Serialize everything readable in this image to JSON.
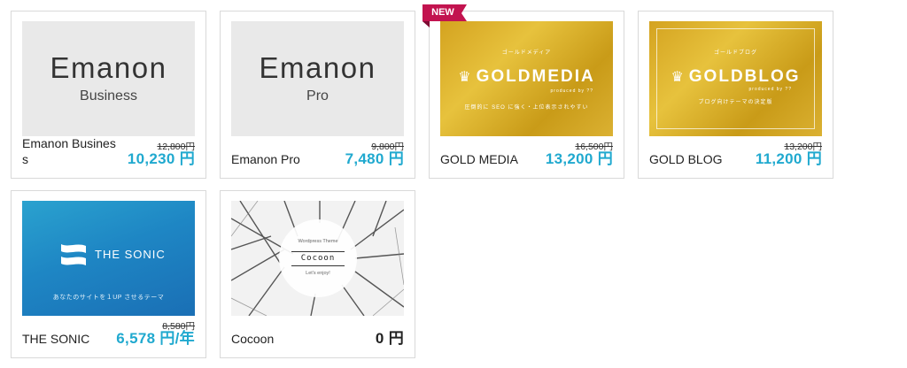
{
  "products": [
    {
      "name": "Emanon Business",
      "old_price": "12,800円",
      "price": "10,230 円",
      "thumb": {
        "logo": "Emanon",
        "sub": "Business"
      }
    },
    {
      "name": "Emanon Pro",
      "old_price": "9,800円",
      "price": "7,480 円",
      "thumb": {
        "logo": "Emanon",
        "sub": "Pro"
      }
    },
    {
      "name": "GOLD MEDIA",
      "old_price": "16,500円",
      "price": "13,200 円",
      "badge": "NEW",
      "thumb": {
        "top": "ゴールドメディア",
        "title": "GOLDMEDIA",
        "by": "produced by ??",
        "tagline": "圧倒的に SEO に強く・上位表示されやすい"
      }
    },
    {
      "name": "GOLD BLOG",
      "old_price": "13,200円",
      "price": "11,200 円",
      "thumb": {
        "top": "ゴールドブログ",
        "title": "GOLDBLOG",
        "by": "produced by ??",
        "tagline": "ブログ向けテーマの決定版"
      }
    },
    {
      "name": "THE SONIC",
      "old_price": "8,580円",
      "price": "6,578 円/年",
      "thumb": {
        "title": "THE SONIC",
        "tagline": "あなたのサイトを１UP させるテーマ"
      }
    },
    {
      "name": "Cocoon",
      "price": "0 円",
      "thumb": {
        "top": "Wordpress Theme",
        "title": "Cocoon",
        "bottom": "Let's enjoy!"
      }
    }
  ],
  "colors": {
    "price": "#20a9cf",
    "badge": "#c2134f",
    "gold": "#d9ad2a",
    "sonic": "#1e86c4"
  },
  "icons": {
    "gold_logo": "crown-icon",
    "sonic_logo": "wave-flag-icon"
  }
}
